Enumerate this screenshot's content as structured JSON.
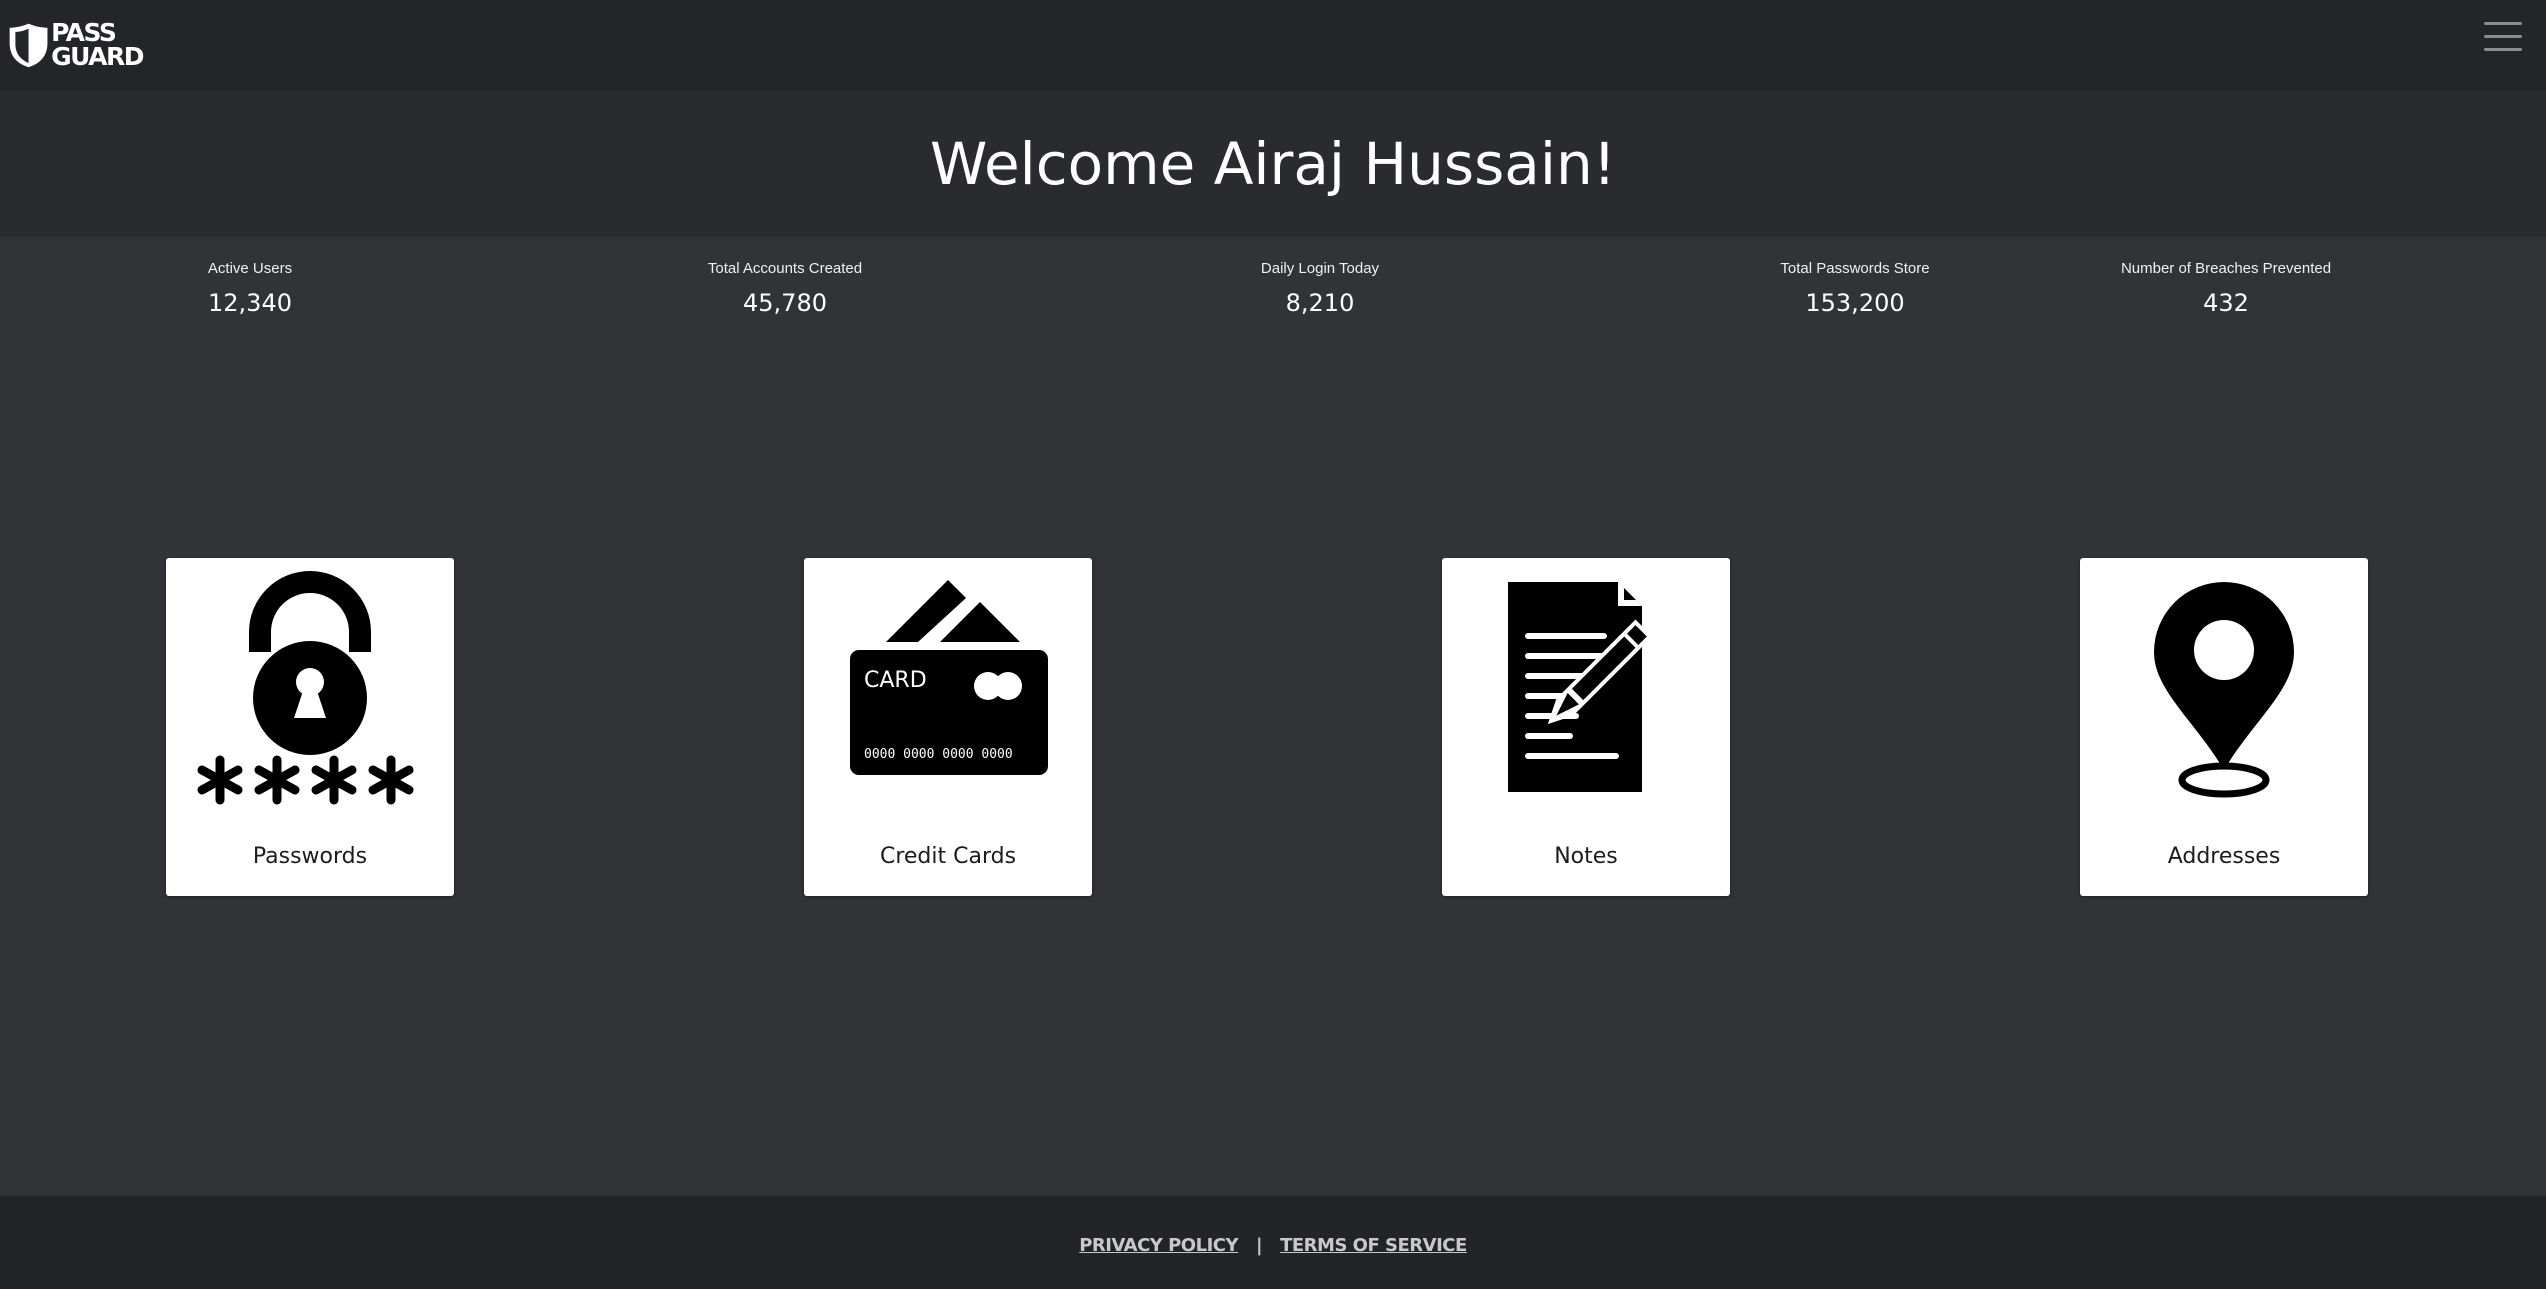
{
  "header": {
    "logo_line1": "PASS",
    "logo_line2": "GUARD",
    "menu_icon": "hamburger-menu-icon"
  },
  "welcome": {
    "title": "Welcome Airaj Hussain!"
  },
  "stats": [
    {
      "label": "Active Users",
      "value": "12,340"
    },
    {
      "label": "Total Accounts Created",
      "value": "45,780"
    },
    {
      "label": "Daily Login Today",
      "value": "8,210"
    },
    {
      "label": "Total Passwords Store",
      "value": "153,200"
    },
    {
      "label": "Number of Breaches Prevented",
      "value": "432"
    }
  ],
  "cards": [
    {
      "title": "Passwords",
      "icon": "padlock-password-icon"
    },
    {
      "title": "Credit Cards",
      "icon": "credit-card-icon",
      "card_text": "CARD",
      "card_number": "0000 0000 0000 0000"
    },
    {
      "title": "Notes",
      "icon": "note-pencil-icon"
    },
    {
      "title": "Addresses",
      "icon": "map-pin-icon"
    }
  ],
  "footer": {
    "privacy": "PRIVACY POLICY",
    "separator": "|",
    "terms": "TERMS OF SERVICE"
  },
  "colors": {
    "navbar": "#242528",
    "welcome_band": "#2a2b2e",
    "body": "#323337",
    "footer": "#232427",
    "card": "#ffffff"
  }
}
